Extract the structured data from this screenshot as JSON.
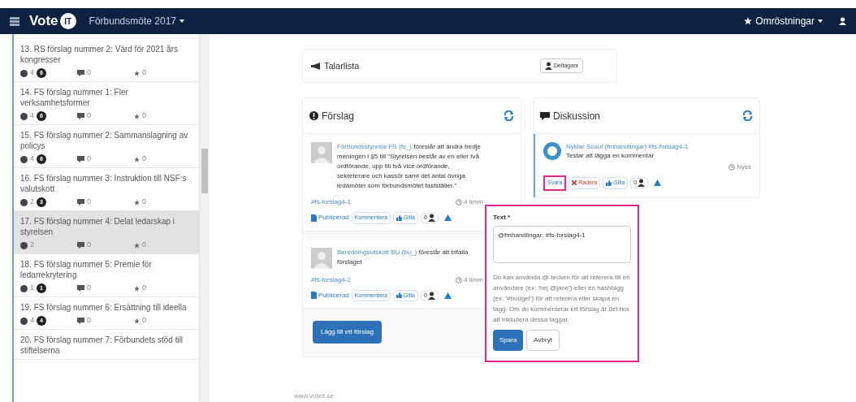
{
  "navbar": {
    "logo_text": "Vote",
    "logo_badge": "IT",
    "meeting": "Förbundsmöte 2017",
    "polls": "Omröstningar"
  },
  "sidebar": {
    "items": [
      {
        "title": "13. RS förslag nummer 2: Värd för 2021 års kongresser",
        "proposals": "4",
        "unread": "6",
        "comments": "0",
        "stars": "0",
        "selected": false
      },
      {
        "title": "14. FS förslag nummer 1: Fler verksamhetsformer",
        "proposals": "4",
        "unread": "6",
        "comments": "0",
        "stars": "0",
        "selected": false
      },
      {
        "title": "15. FS förslag nummer 2: Sammanslagning av policys",
        "proposals": "4",
        "unread": "6",
        "comments": "0",
        "stars": "0",
        "selected": false
      },
      {
        "title": "16. FS förslag nummer 3: Instruktion till NSF:s valutskott",
        "proposals": "2",
        "unread": "3",
        "comments": "0",
        "stars": "0",
        "selected": false
      },
      {
        "title": "17. FS förslag nummer 4: Delat ledarskap i styrelsen",
        "proposals": "2",
        "comments": "0",
        "stars": "0",
        "selected": true
      },
      {
        "title": "18. FS förslag nummer 5: Premie för ledarrekrytering",
        "proposals": "1",
        "unread": "1",
        "comments": "0",
        "stars": "0",
        "selected": false
      },
      {
        "title": "19. FS förslag nummer 6: Ersättning till ideella",
        "proposals": "4",
        "unread": "4",
        "comments": "0",
        "stars": "0",
        "selected": false
      },
      {
        "title": "20. FS förslag nummer 7: Förbundets stöd till stiftelserna",
        "selected": false
      }
    ]
  },
  "speakers": {
    "title": "Talarlista",
    "button": "Deltagare"
  },
  "proposals": {
    "title": "Förslag",
    "items": [
      {
        "author": "Förbundsstyrelse FS (fs_)",
        "text": "föreslår att ändra tredje meningen i §5 till \"Styrelsen består av en eller två ordförande, upp till två vice ordförande, sekreterare och kassör samt det antal övriga ledamöter som förbundsmötet fastställer.\"",
        "tag": "#fs-forslag4-1",
        "time": "4 timm",
        "state": "Publicerad",
        "comment": "Kommentera",
        "like": "Gilla",
        "likes": "0"
      },
      {
        "author": "Beredningsutskott BU (bu_)",
        "text": "föreslår att bifalla förslaget",
        "tag": "#fs-forslag4-2",
        "time": "4 timm",
        "state": "Publicerad",
        "comment": "Kommentera",
        "like": "Gilla",
        "likes": "0"
      }
    ],
    "add_button": "Lägg till ett förslag"
  },
  "discussion": {
    "title": "Diskussion",
    "items": [
      {
        "author": "Nyklar Scout (fmhandlingar) #fs-forslag4-1",
        "text": "Testar att lägga en kommentar",
        "time": "Nyss",
        "reply": "Svara",
        "delete": "Radera",
        "like": "Gilla",
        "likes": "0"
      }
    ]
  },
  "reply_form": {
    "label": "Text *",
    "value": "@fmhandlingar: #fs-forslag4-1",
    "help": "Du kan använda @-tecken för att referera till en användare (ex: 'hej @jane') eller en hashtagg (ex: '#budget') för att referera eller skapa en tagg. Om du kommenterar ett förslag är det bra att inkludera dessa taggar.",
    "save": "Spara",
    "cancel": "Avbryt"
  },
  "footer": "www.voteit.se"
}
